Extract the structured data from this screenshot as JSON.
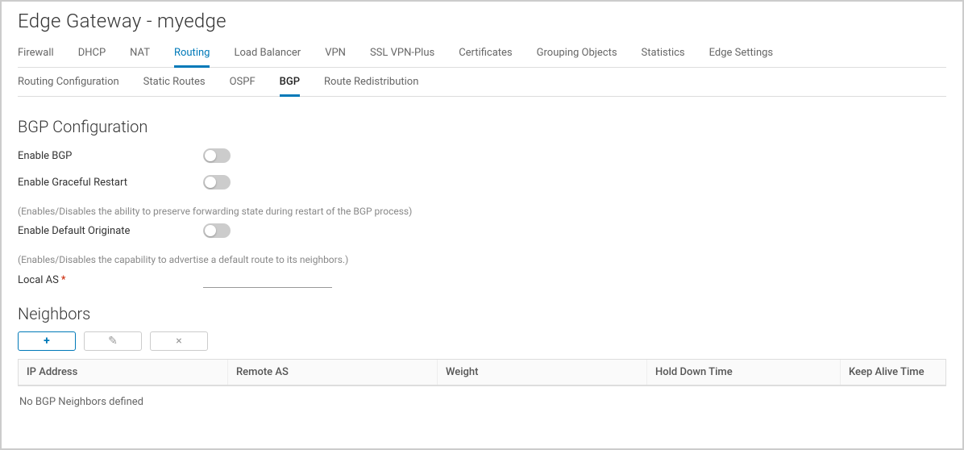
{
  "header": {
    "title": "Edge Gateway - myedge"
  },
  "tabs": {
    "items": [
      "Firewall",
      "DHCP",
      "NAT",
      "Routing",
      "Load Balancer",
      "VPN",
      "SSL VPN-Plus",
      "Certificates",
      "Grouping Objects",
      "Statistics",
      "Edge Settings"
    ],
    "activeIndex": 3
  },
  "subtabs": {
    "items": [
      "Routing Configuration",
      "Static Routes",
      "OSPF",
      "BGP",
      "Route Redistribution"
    ],
    "activeIndex": 3
  },
  "bgp": {
    "sectionTitle": "BGP Configuration",
    "enableBgpLabel": "Enable BGP",
    "enableBgp": false,
    "gracefulRestartLabel": "Enable Graceful Restart",
    "gracefulRestart": false,
    "gracefulRestartHelp": "(Enables/Disables the ability to preserve forwarding state during restart of the BGP process)",
    "defaultOriginateLabel": "Enable Default Originate",
    "defaultOriginate": false,
    "defaultOriginateHelp": "(Enables/Disables the capability to advertise a default route to its neighbors.)",
    "localAsLabel": "Local AS",
    "localAsValue": ""
  },
  "neighbors": {
    "sectionTitle": "Neighbors",
    "columns": {
      "ip": "IP Address",
      "remoteAs": "Remote AS",
      "weight": "Weight",
      "holdDown": "Hold Down Time",
      "keepAlive": "Keep Alive Time"
    },
    "rows": [],
    "emptyMessage": "No BGP Neighbors defined"
  },
  "icons": {
    "plus": "+",
    "edit": "✎",
    "delete": "×"
  }
}
